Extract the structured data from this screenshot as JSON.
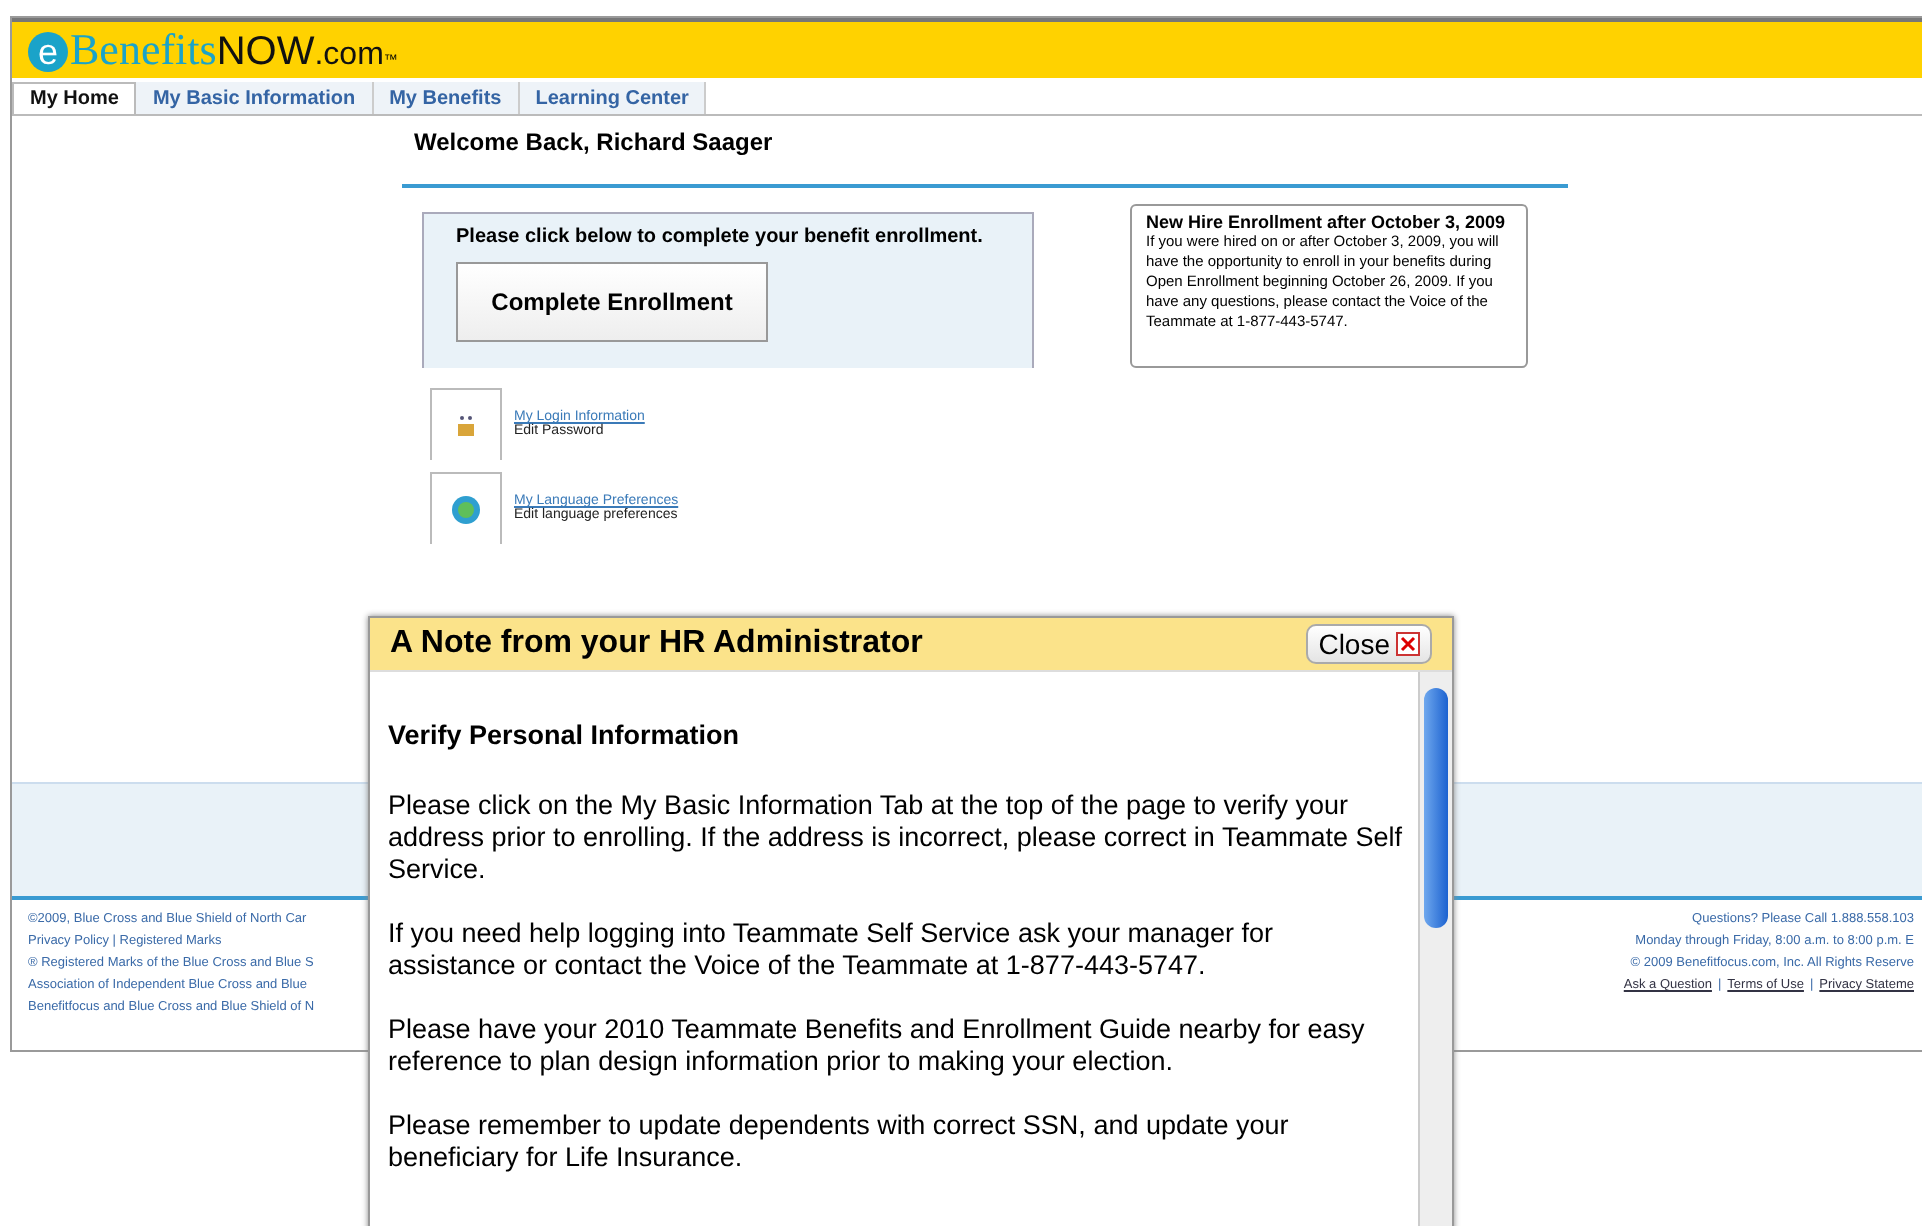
{
  "logo": {
    "letter": "e",
    "name": "Benefits",
    "suffix": "NOW",
    "domain": ".com",
    "mark": "™"
  },
  "tabs": [
    {
      "label": "My Home",
      "selected": true
    },
    {
      "label": "My Basic Information",
      "selected": false
    },
    {
      "label": "My Benefits",
      "selected": false
    },
    {
      "label": "Learning Center",
      "selected": false
    }
  ],
  "welcome": "Welcome Back, Richard Saager",
  "enrollment": {
    "prompt": "Please click below to complete your benefit enrollment.",
    "button": "Complete Enrollment"
  },
  "notice": {
    "title": "New Hire Enrollment after October 3, 2009",
    "body": "If you were hired on or after October 3, 2009, you will have the opportunity to enroll in your benefits during Open Enrollment beginning October 26, 2009. If you have any questions, please contact the Voice of the Teammate at 1-877-443-5747."
  },
  "links": [
    {
      "kind": "login",
      "title": "My Login Information",
      "subtitle": "Edit Password"
    },
    {
      "kind": "language",
      "title": "My Language Preferences",
      "subtitle": "Edit language preferences"
    }
  ],
  "footer_left": [
    "©2009, Blue Cross and Blue Shield of North Car",
    "Privacy Policy | Registered Marks",
    "® Registered Marks of the Blue Cross and Blue S",
    "Association of Independent Blue Cross and Blue",
    "Benefitfocus and Blue Cross and Blue Shield of N"
  ],
  "footer_right": {
    "lines": [
      "Questions? Please Call 1.888.558.103",
      "Monday through Friday, 8:00 a.m. to 8:00 p.m. E",
      "© 2009 Benefitfocus.com, Inc. All Rights Reserve"
    ],
    "links": [
      "Ask a Question",
      "Terms of Use",
      "Privacy Stateme"
    ],
    "separator": "|"
  },
  "dialog": {
    "title": "A Note from your HR Administrator",
    "close": "Close",
    "heading": "Verify Personal Information",
    "paragraphs": [
      "Please click on the My Basic Information Tab at the top of the page to verify your address prior to enrolling. If the address is incorrect, please correct in Teammate Self Service.",
      "If you need help logging into Teammate Self Service ask your manager for assistance or contact the Voice of the Teammate at 1-877-443-5747.",
      "Please have your 2010 Teammate Benefits and Enrollment Guide nearby for easy reference to plan design information prior to making your election.",
      "Please remember to update dependents with correct SSN, and update your beneficiary for Life Insurance."
    ]
  }
}
